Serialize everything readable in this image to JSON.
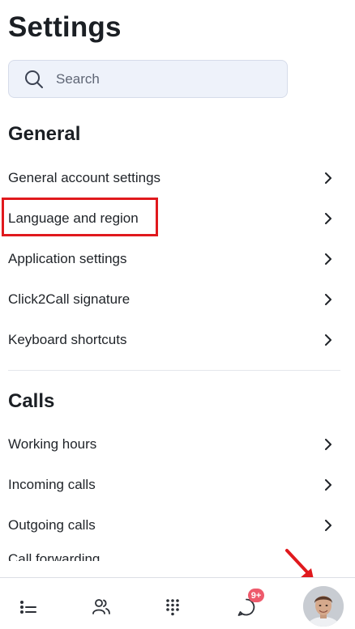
{
  "page": {
    "title": "Settings"
  },
  "search": {
    "placeholder": "Search",
    "icon": "search-icon"
  },
  "general": {
    "heading": "General",
    "items": [
      {
        "label": "General account settings"
      },
      {
        "label": "Language and region",
        "highlighted": true
      },
      {
        "label": "Application settings"
      },
      {
        "label": "Click2Call signature"
      },
      {
        "label": "Keyboard shortcuts"
      }
    ]
  },
  "calls": {
    "heading": "Calls",
    "items": [
      {
        "label": "Working hours"
      },
      {
        "label": "Incoming calls"
      },
      {
        "label": "Outgoing calls"
      },
      {
        "label": "Call forwarding"
      }
    ]
  },
  "bottom_nav": {
    "items": [
      {
        "icon": "list-icon"
      },
      {
        "icon": "contacts-icon"
      },
      {
        "icon": "dialpad-icon"
      },
      {
        "icon": "chat-icon",
        "badge": "9+"
      },
      {
        "icon": "avatar"
      }
    ]
  },
  "colors": {
    "highlight": "#e0191d",
    "badge": "#ee5a6c",
    "search_bg": "#eef2fa"
  }
}
